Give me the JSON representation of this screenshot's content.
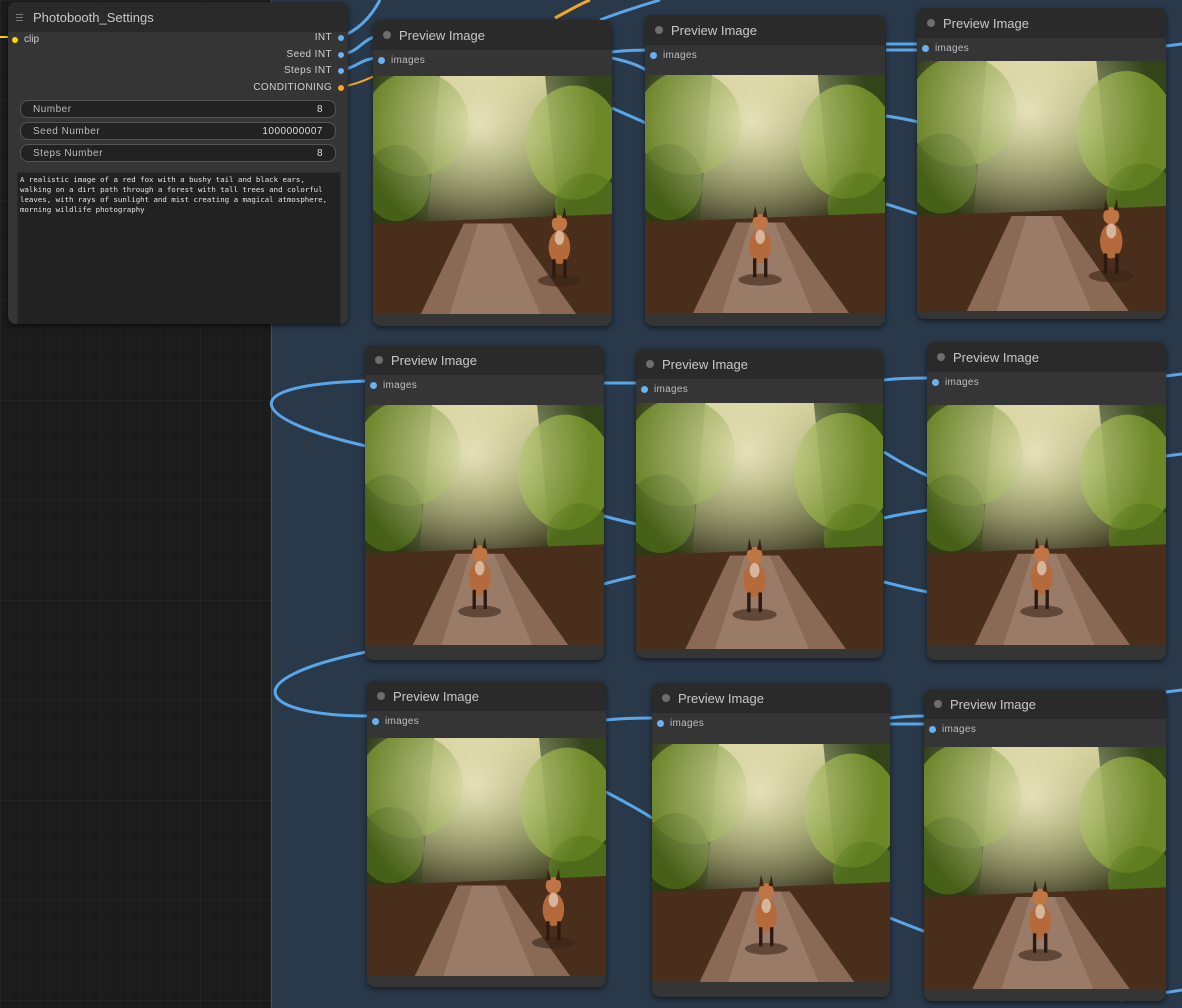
{
  "settings_node": {
    "title": "Photobooth_Settings",
    "input_clip": "clip",
    "outputs": [
      "INT",
      "Seed INT",
      "Steps INT",
      "CONDITIONING"
    ],
    "widgets": [
      {
        "label": "Number",
        "value": "8"
      },
      {
        "label": "Seed Number",
        "value": "1000000007"
      },
      {
        "label": "Steps Number",
        "value": "8"
      }
    ],
    "prompt": "A realistic image of a red fox with a bushy tail and black ears, walking on a dirt path through a forest with tall trees and colorful leaves, with rays of sunlight and mist creating a magical atmosphere, morning wildlife photography"
  },
  "preview_nodes": [
    {
      "title": "Preview Image",
      "input": "images"
    },
    {
      "title": "Preview Image",
      "input": "images"
    },
    {
      "title": "Preview Image",
      "input": "images"
    },
    {
      "title": "Preview Image",
      "input": "images"
    },
    {
      "title": "Preview Image",
      "input": "images"
    },
    {
      "title": "Preview Image",
      "input": "images"
    },
    {
      "title": "Preview Image",
      "input": "images"
    },
    {
      "title": "Preview Image",
      "input": "images"
    },
    {
      "title": "Preview Image",
      "input": "images"
    }
  ],
  "colors": {
    "link_int": "#6ab0f3",
    "link_conditioning": "#f5a623",
    "clip": "#ffd500",
    "group": "#29394a"
  }
}
